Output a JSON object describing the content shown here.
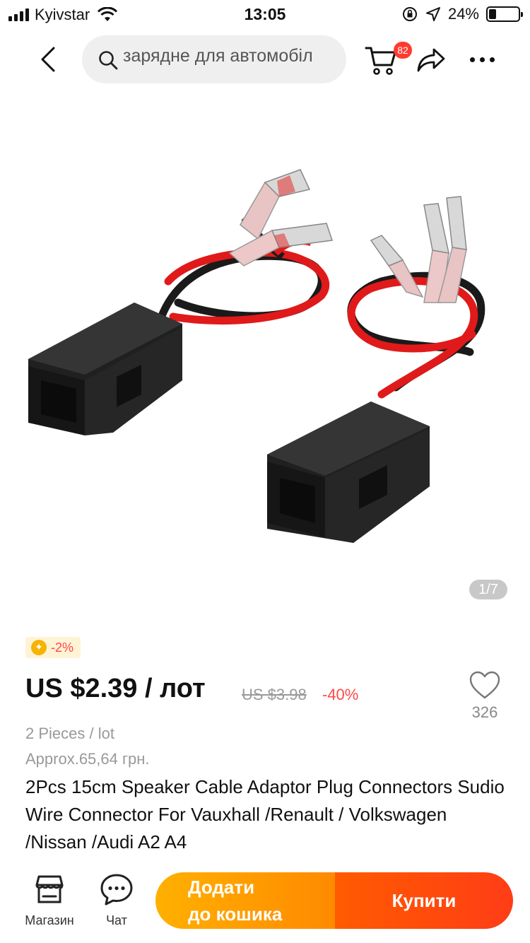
{
  "status_bar": {
    "carrier": "Kyivstar",
    "time": "13:05",
    "battery_percent": "24%",
    "battery_level": 0.24,
    "icons": [
      "signal-icon",
      "wifi-icon",
      "orientation-lock-icon",
      "location-icon",
      "battery-icon"
    ]
  },
  "nav": {
    "back_icon": "chevron-left-icon",
    "search_text": "зарядне для автомобіл",
    "search_icon": "search-icon",
    "cart_icon": "cart-icon",
    "cart_badge": "82",
    "share_icon": "share-icon",
    "more_icon": "more-icon"
  },
  "gallery": {
    "page_indicator": "1/7"
  },
  "product": {
    "coin_icon_glyph": "✦",
    "coin_discount": "-2%",
    "price": "US $2.39 / лот",
    "original_price": "US $3.98",
    "discount": "-40%",
    "wishlist_count": "326",
    "pieces": "2 Pieces / lot",
    "approx": "Approx.65,64 грн.",
    "title": "2Pcs 15cm Speaker Cable Adaptor Plug Connectors Sudio Wire Connector For Vauxhall /Renault / Volkswagen /Nissan /Audi A2 A4"
  },
  "bottom_bar": {
    "store_label": "Магазин",
    "chat_label": "Чат",
    "add_to_cart_line1": "Додати",
    "add_to_cart_line2": "до кошика",
    "buy_now": "Купити",
    "colors": {
      "add_to_cart": "#ffa000",
      "buy_now": "#ff4c0c"
    }
  }
}
